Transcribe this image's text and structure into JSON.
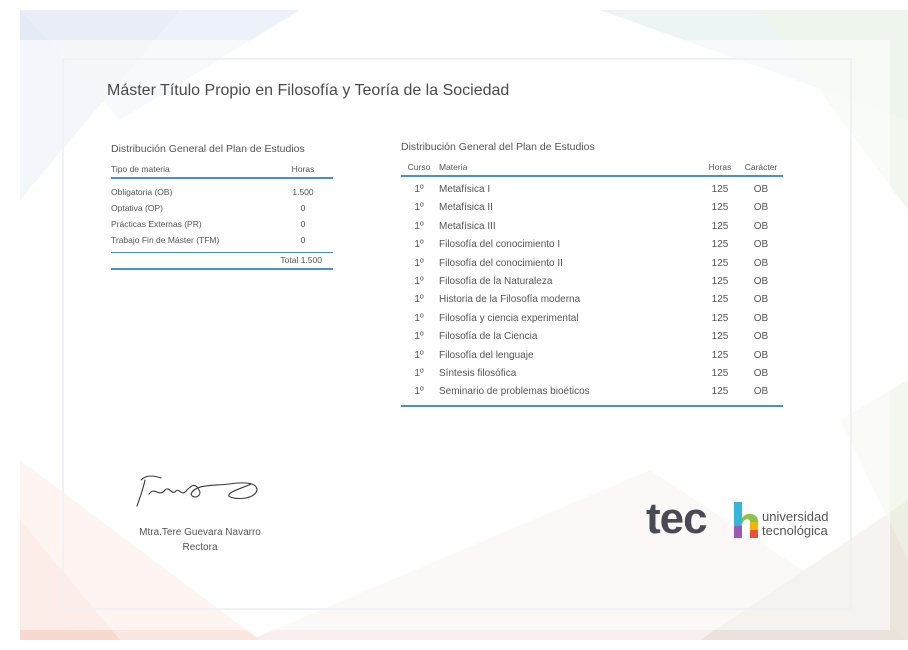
{
  "title": "Máster Título Propio en Filosofía y Teoría de la Sociedad",
  "left_table": {
    "title": "Distribución General del Plan de Estudios",
    "header": {
      "tipo": "Tipo de materia",
      "horas": "Horas"
    },
    "rows": [
      {
        "tipo": "Obligatoria (OB)",
        "horas": "1.500"
      },
      {
        "tipo": "Optativa (OP)",
        "horas": "0"
      },
      {
        "tipo": "Prácticas Externas (PR)",
        "horas": "0"
      },
      {
        "tipo": "Trabajo Fin de Máster (TFM)",
        "horas": "0"
      }
    ],
    "total": "Total 1.500"
  },
  "right_table": {
    "title": "Distribución General del Plan de Estudios",
    "header": {
      "curso": "Curso",
      "materia": "Materia",
      "horas": "Horas",
      "caracter": "Carácter"
    },
    "rows": [
      {
        "curso": "1º",
        "materia": "Metafísica I",
        "horas": "125",
        "caracter": "OB"
      },
      {
        "curso": "1º",
        "materia": "Metafísica II",
        "horas": "125",
        "caracter": "OB"
      },
      {
        "curso": "1º",
        "materia": "Metafísica III",
        "horas": "125",
        "caracter": "OB"
      },
      {
        "curso": "1º",
        "materia": "Filosofía del conocimiento I",
        "horas": "125",
        "caracter": "OB"
      },
      {
        "curso": "1º",
        "materia": "Filosofía del conocimiento II",
        "horas": "125",
        "caracter": "OB"
      },
      {
        "curso": "1º",
        "materia": "Filosofía de la Naturaleza",
        "horas": "125",
        "caracter": "OB"
      },
      {
        "curso": "1º",
        "materia": "Historia de la Filosofía moderna",
        "horas": "125",
        "caracter": "OB"
      },
      {
        "curso": "1º",
        "materia": "Filosofía y ciencia experimental",
        "horas": "125",
        "caracter": "OB"
      },
      {
        "curso": "1º",
        "materia": "Filosofía de la Ciencia",
        "horas": "125",
        "caracter": "OB"
      },
      {
        "curso": "1º",
        "materia": "Filosofía del lenguaje",
        "horas": "125",
        "caracter": "OB"
      },
      {
        "curso": "1º",
        "materia": "Síntesis filosófica",
        "horas": "125",
        "caracter": "OB"
      },
      {
        "curso": "1º",
        "materia": "Seminario de problemas bioéticos",
        "horas": "125",
        "caracter": "OB"
      }
    ]
  },
  "signature": {
    "name": "Mtra.Tere Guevara Navarro",
    "role": "Rectora"
  },
  "logo": {
    "word": "tec",
    "line1": "universidad",
    "line2": "tecnológica",
    "colors": [
      "#35b5d8",
      "#8bc34a",
      "#f2b705",
      "#e8503a",
      "#9b59b6"
    ]
  }
}
